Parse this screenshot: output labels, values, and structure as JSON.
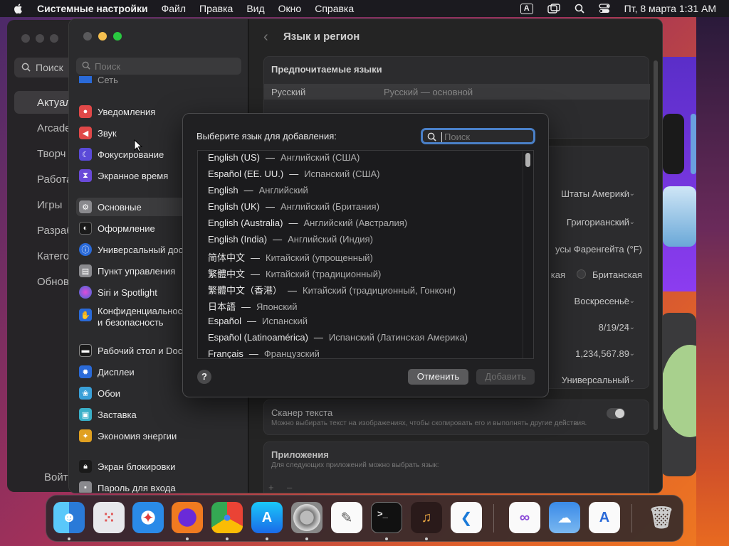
{
  "menubar": {
    "app_name": "Системные настройки",
    "items": [
      "Файл",
      "Правка",
      "Вид",
      "Окно",
      "Справка"
    ],
    "input_source": "A",
    "datetime": "Пт, 8 марта  1:31 AM"
  },
  "bg_app": {
    "search_placeholder": "Поиск",
    "sidebar": [
      "Актуал",
      "Arcade",
      "Творч",
      "Работа",
      "Игры",
      "Разраб",
      "Катего",
      "Обнов"
    ],
    "signin": "Войт"
  },
  "settings": {
    "search_placeholder": "Поиск",
    "sidebar": {
      "top_partial": "Сеть",
      "group1": [
        "Уведомления",
        "Звук",
        "Фокусирование",
        "Экранное время"
      ],
      "group2": [
        "Основные",
        "Оформление",
        "Универсальный доступ",
        "Пункт управления",
        "Siri и Spotlight",
        "Конфиденциальность и безопасность"
      ],
      "group3": [
        "Рабочий стол и Dock",
        "Дисплеи",
        "Обои",
        "Заставка",
        "Экономия энергии"
      ],
      "group4": [
        "Экран блокировки",
        "Пароль для входа"
      ]
    },
    "title": "Язык и регион",
    "preferred_languages_header": "Предпочитаемые языки",
    "preferred_language": {
      "name": "Русский",
      "detail": "Русский — основной"
    },
    "values": {
      "region": "Штаты Америки",
      "calendar": "Григорианский",
      "temperature": "усы Фаренгейта (°F)",
      "measurement_a": "кая",
      "measurement_b": "Британская",
      "first_day": "Воскресенье",
      "date_format": "8/19/24",
      "number_format": "1,234,567.89",
      "list_sort": "Универсальный"
    },
    "live_text_title": "Сканер текста",
    "live_text_desc": "Можно выбирать текст на изображениях, чтобы скопировать его и выполнять другие действия.",
    "apps_title": "Приложения",
    "apps_desc": "Для следующих приложений можно выбрать язык:",
    "add_remove": [
      "+",
      "–"
    ]
  },
  "sheet": {
    "prompt": "Выберите язык для добавления:",
    "search_placeholder": "Поиск",
    "languages": [
      {
        "native": "English (US)",
        "ru": "Английский (США)"
      },
      {
        "native": "Español (EE. UU.)",
        "ru": "Испанский (США)"
      },
      {
        "native": "English",
        "ru": "Английский"
      },
      {
        "native": "English (UK)",
        "ru": "Английский (Британия)"
      },
      {
        "native": "English (Australia)",
        "ru": "Английский (Австралия)"
      },
      {
        "native": "English (India)",
        "ru": "Английский (Индия)"
      },
      {
        "native": "简体中文",
        "ru": "Китайский (упрощенный)"
      },
      {
        "native": "繁體中文",
        "ru": "Китайский (традиционный)"
      },
      {
        "native": "繁體中文（香港）",
        "ru": "Китайский (традиционный, Гонконг)"
      },
      {
        "native": "日本語",
        "ru": "Японский"
      },
      {
        "native": "Español",
        "ru": "Испанский"
      },
      {
        "native": "Español (Latinoamérica)",
        "ru": "Испанский (Латинская Америка)"
      },
      {
        "native": "Français",
        "ru": "Французский"
      }
    ],
    "separator": "—",
    "help": "?",
    "cancel": "Отменить",
    "add": "Добавить"
  },
  "dock": {
    "apps": [
      "finder-icon",
      "launchpad-icon",
      "safari-icon",
      "firefox-icon",
      "chrome-icon",
      "app-store-icon",
      "system-settings-icon",
      "textedit-icon",
      "terminal-icon",
      "garageband-icon",
      "vscode-icon",
      "visual-studio-icon",
      "weather-icon",
      "xcode-instruments-icon",
      "trash-icon"
    ],
    "terminal_glyph": ">_"
  },
  "colors": {
    "accent": "#4a80c8",
    "sheet_bg": "#202022",
    "sidebar_bg": "#2b2b2d"
  }
}
